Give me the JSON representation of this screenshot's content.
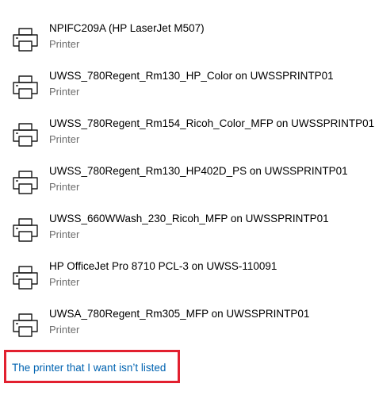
{
  "printers": [
    {
      "name": "NPIFC209A (HP LaserJet M507)",
      "type": "Printer",
      "icon": "printer-icon"
    },
    {
      "name": "UWSS_780Regent_Rm130_HP_Color on UWSSPRINTP01",
      "type": "Printer",
      "icon": "printer-icon"
    },
    {
      "name": "UWSS_780Regent_Rm154_Ricoh_Color_MFP on UWSSPRINTP01",
      "type": "Printer",
      "icon": "printer-icon"
    },
    {
      "name": "UWSS_780Regent_Rm130_HP402D_PS on UWSSPRINTP01",
      "type": "Printer",
      "icon": "printer-icon"
    },
    {
      "name": "UWSS_660WWash_230_Ricoh_MFP on UWSSPRINTP01",
      "type": "Printer",
      "icon": "printer-icon"
    },
    {
      "name": "HP OfficeJet Pro 8710 PCL-3 on UWSS-110091",
      "type": "Printer",
      "icon": "printer-icon"
    },
    {
      "name": "UWSA_780Regent_Rm305_MFP on UWSSPRINTP01",
      "type": "Printer",
      "icon": "printer-icon"
    }
  ],
  "not_listed_link": "The printer that I want isn’t listed",
  "colors": {
    "link": "#0063b1",
    "secondary_text": "#6d6d6d",
    "highlight_border": "#e2202f"
  }
}
